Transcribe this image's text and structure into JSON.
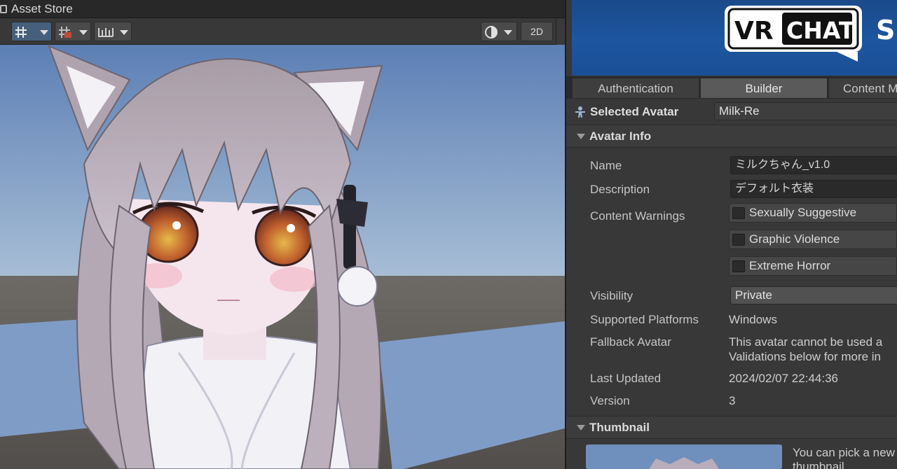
{
  "scene": {
    "tab_title": "Asset Store",
    "toolbar": {
      "grid_icon": "grid-snap-icon",
      "increment_icon": "increment-snap-icon",
      "ruler_icon": "ruler-icon",
      "shading_icon": "shading-mode-icon",
      "mode_2d_label": "2D"
    }
  },
  "inspector": {
    "banner": {
      "logo_vr": "VR",
      "logo_chat": "CHAT",
      "logo_trailing": "S"
    },
    "tabs": [
      {
        "label": "Authentication"
      },
      {
        "label": "Builder"
      },
      {
        "label": "Content M"
      }
    ],
    "selected_avatar": {
      "label": "Selected Avatar",
      "value": "Milk-Re",
      "icon": "avatar-person-icon"
    },
    "avatar_info": {
      "title": "Avatar Info",
      "name_label": "Name",
      "name_value": "ミルクちゃん_v1.0",
      "description_label": "Description",
      "description_value": "デフォルト衣装",
      "content_warnings_label": "Content Warnings",
      "warnings": [
        {
          "label": "Sexually Suggestive",
          "checked": false
        },
        {
          "label": "Graphic Violence",
          "checked": false
        },
        {
          "label": "Extreme Horror",
          "checked": false
        }
      ],
      "visibility_label": "Visibility",
      "visibility_value": "Private",
      "platforms_label": "Supported Platforms",
      "platforms_value": "Windows",
      "fallback_label": "Fallback Avatar",
      "fallback_line1": "This avatar cannot be used a",
      "fallback_line2": "Validations below for more in",
      "updated_label": "Last Updated",
      "updated_value": "2024/02/07 22:44:36",
      "version_label": "Version",
      "version_value": "3"
    },
    "thumbnail": {
      "title": "Thumbnail",
      "hint_line1": "You can pick a new",
      "hint_line2": "thumbnail"
    }
  }
}
